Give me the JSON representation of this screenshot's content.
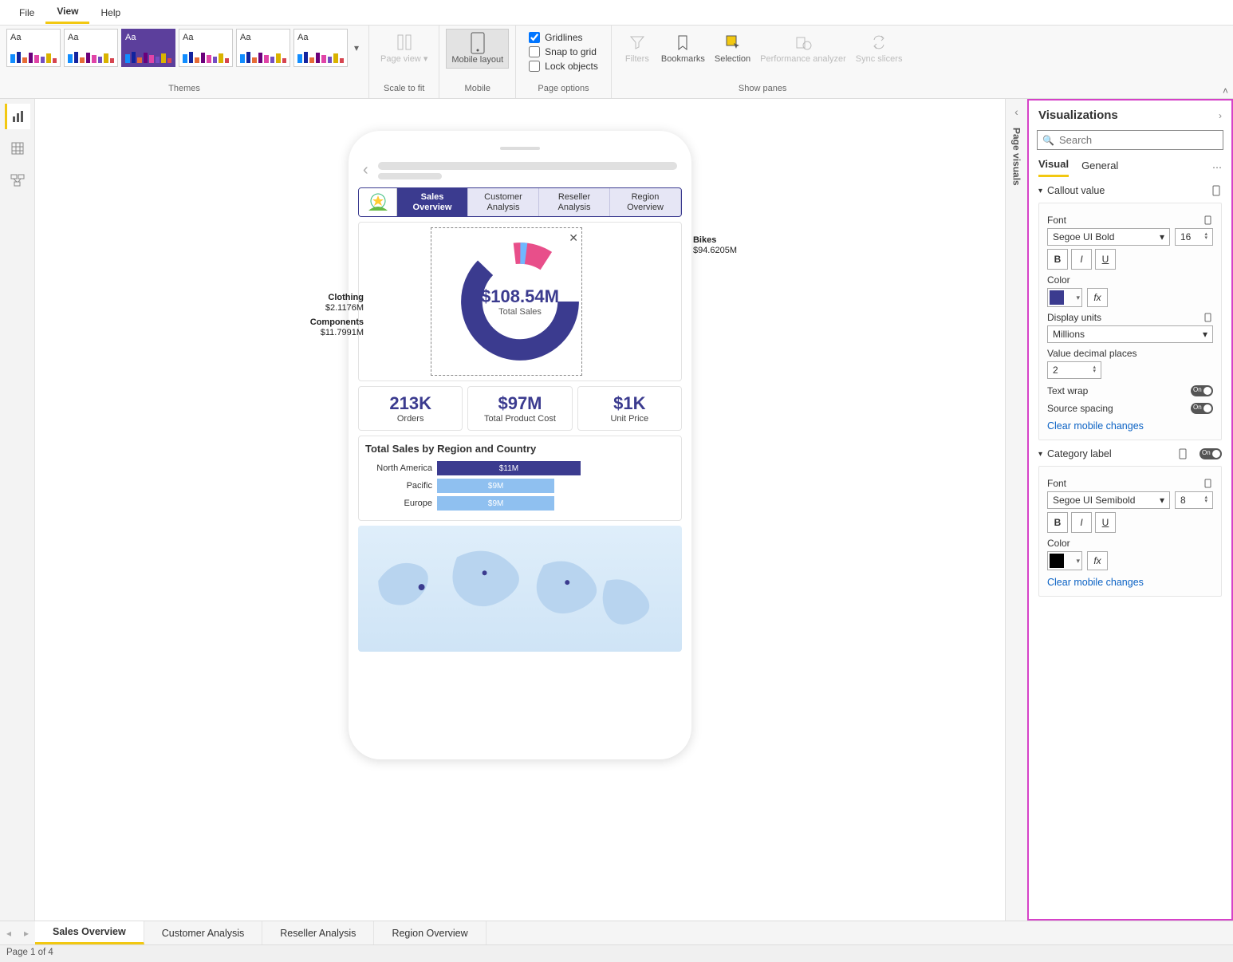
{
  "menu": {
    "file": "File",
    "view": "View",
    "help": "Help"
  },
  "ribbon": {
    "themes_label": "Themes",
    "theme_aa": "Aa",
    "scale_to_fit": "Scale to fit",
    "page_view": "Page view",
    "mobile_group": "Mobile",
    "mobile_layout": "Mobile layout",
    "page_options_label": "Page options",
    "gridlines": "Gridlines",
    "snap": "Snap to grid",
    "lock": "Lock objects",
    "show_panes_label": "Show panes",
    "filters": "Filters",
    "bookmarks": "Bookmarks",
    "selection": "Selection",
    "perf": "Performance analyzer",
    "sync": "Sync slicers"
  },
  "collapsed_rail": "Page visuals",
  "phone": {
    "tabs": [
      "Sales Overview",
      "Customer Analysis",
      "Reseller Analysis",
      "Region Overview"
    ],
    "donut": {
      "center_value": "$108.54M",
      "center_label": "Total Sales",
      "labels": {
        "bikes": "Bikes",
        "bikes_v": "$94.6205M",
        "clothing": "Clothing",
        "clothing_v": "$2.1176M",
        "components": "Components",
        "components_v": "$11.7991M"
      }
    },
    "kpis": [
      {
        "value": "213K",
        "label": "Orders"
      },
      {
        "value": "$97M",
        "label": "Total Product Cost"
      },
      {
        "value": "$1K",
        "label": "Unit Price"
      }
    ],
    "bar_title": "Total Sales by Region and Country"
  },
  "chart_data": {
    "donut": {
      "type": "pie",
      "title": "Total Sales",
      "total": "$108.54M",
      "series": [
        {
          "name": "Bikes",
          "value": 94.6205,
          "color": "#3b3b8f"
        },
        {
          "name": "Components",
          "value": 11.7991,
          "color": "#e84f8a"
        },
        {
          "name": "Clothing",
          "value": 2.1176,
          "color": "#6fb7ff"
        }
      ],
      "units": "Millions USD"
    },
    "region_bars": {
      "type": "bar",
      "orientation": "horizontal",
      "title": "Total Sales by Region and Country",
      "categories": [
        "North America",
        "Pacific",
        "Europe"
      ],
      "values": [
        11,
        9,
        9
      ],
      "value_labels": [
        "$11M",
        "$9M",
        "$9M"
      ],
      "colors": [
        "#3b3b8f",
        "#8fc0f0",
        "#8fc0f0"
      ],
      "units": "Millions USD"
    }
  },
  "viz": {
    "title": "Visualizations",
    "search_placeholder": "Search",
    "tabs": {
      "visual": "Visual",
      "general": "General"
    },
    "callout": {
      "title": "Callout value",
      "font_label": "Font",
      "font_family": "Segoe UI Bold",
      "font_size": "16",
      "color_label": "Color",
      "color": "#3b3b8f",
      "display_units_label": "Display units",
      "display_units": "Millions",
      "decimals_label": "Value decimal places",
      "decimals": "2",
      "text_wrap": "Text wrap",
      "source_spacing": "Source spacing",
      "on": "On",
      "clear": "Clear mobile changes"
    },
    "category": {
      "title": "Category label",
      "font_label": "Font",
      "font_family": "Segoe UI Semibold",
      "font_size": "8",
      "color_label": "Color",
      "color": "#000000",
      "on": "On",
      "clear": "Clear mobile changes"
    }
  },
  "page_tabs": [
    "Sales Overview",
    "Customer Analysis",
    "Reseller Analysis",
    "Region Overview"
  ],
  "status": "Page 1 of 4"
}
